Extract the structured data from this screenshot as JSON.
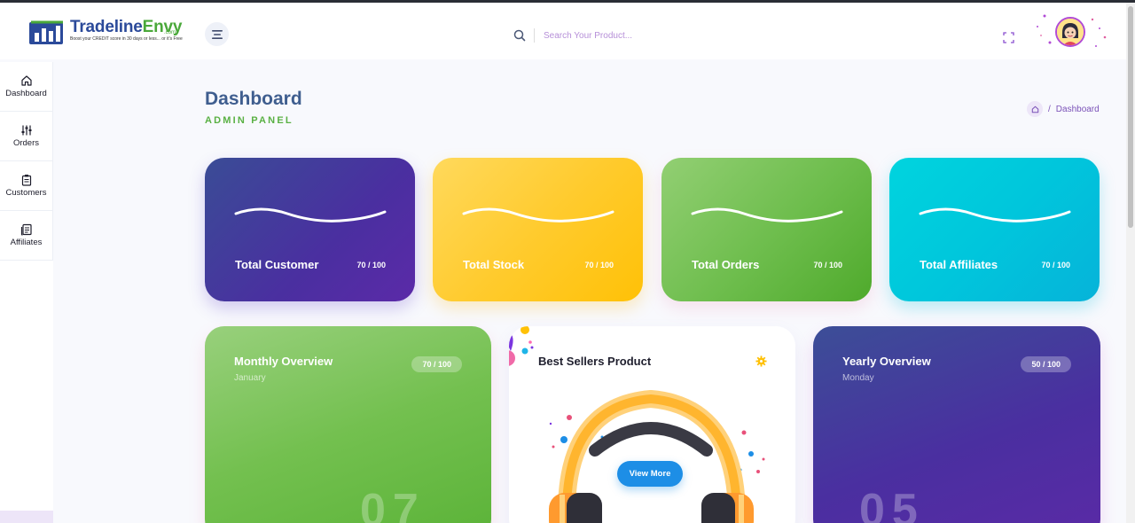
{
  "brand": {
    "name_part1": "Tradeline",
    "name_part2": "Envy",
    "domain_suffix": ".com",
    "tagline": "Boost your CREDIT score in 30 days or less... or it's Free",
    "primary_color": "#2b4a9a",
    "accent_color": "#4aa83a"
  },
  "header": {
    "menu_icon": "hamburger-menu-icon",
    "search": {
      "placeholder": "Search Your Product...",
      "value": "",
      "icon": "search-icon"
    },
    "fullscreen_icon": "fullscreen-icon",
    "avatar_icon": "user-avatar"
  },
  "sidebar": {
    "items": [
      {
        "label": "Dashboard",
        "icon": "home-icon"
      },
      {
        "label": "Orders",
        "icon": "sliders-icon"
      },
      {
        "label": "Customers",
        "icon": "clipboard-icon"
      },
      {
        "label": "Affiliates",
        "icon": "document-icon"
      }
    ]
  },
  "page": {
    "title": "Dashboard",
    "subtitle": "ADMIN PANEL",
    "breadcrumb": {
      "separator": "/",
      "current": "Dashboard",
      "home_icon": "home-icon"
    }
  },
  "stats": [
    {
      "label": "Total Customer",
      "count": "70 / 100",
      "color": "#4a2fa0"
    },
    {
      "label": "Total Stock",
      "count": "70 / 100",
      "color": "#ffc107"
    },
    {
      "label": "Total Orders",
      "count": "70 / 100",
      "color": "#6dbd4c"
    },
    {
      "label": "Total Affiliates",
      "count": "70 / 100",
      "color": "#00c6dc"
    }
  ],
  "cards": {
    "monthly": {
      "title": "Monthly Overview",
      "subtitle": "January",
      "badge": "70 / 100",
      "number": "07"
    },
    "best_sellers": {
      "title": "Best Sellers Product",
      "button": "View More",
      "settings_icon": "gear-icon",
      "image": "headphones-illustration"
    },
    "yearly": {
      "title": "Yearly Overview",
      "subtitle": "Monday",
      "badge": "50 / 100",
      "number": "05"
    }
  }
}
